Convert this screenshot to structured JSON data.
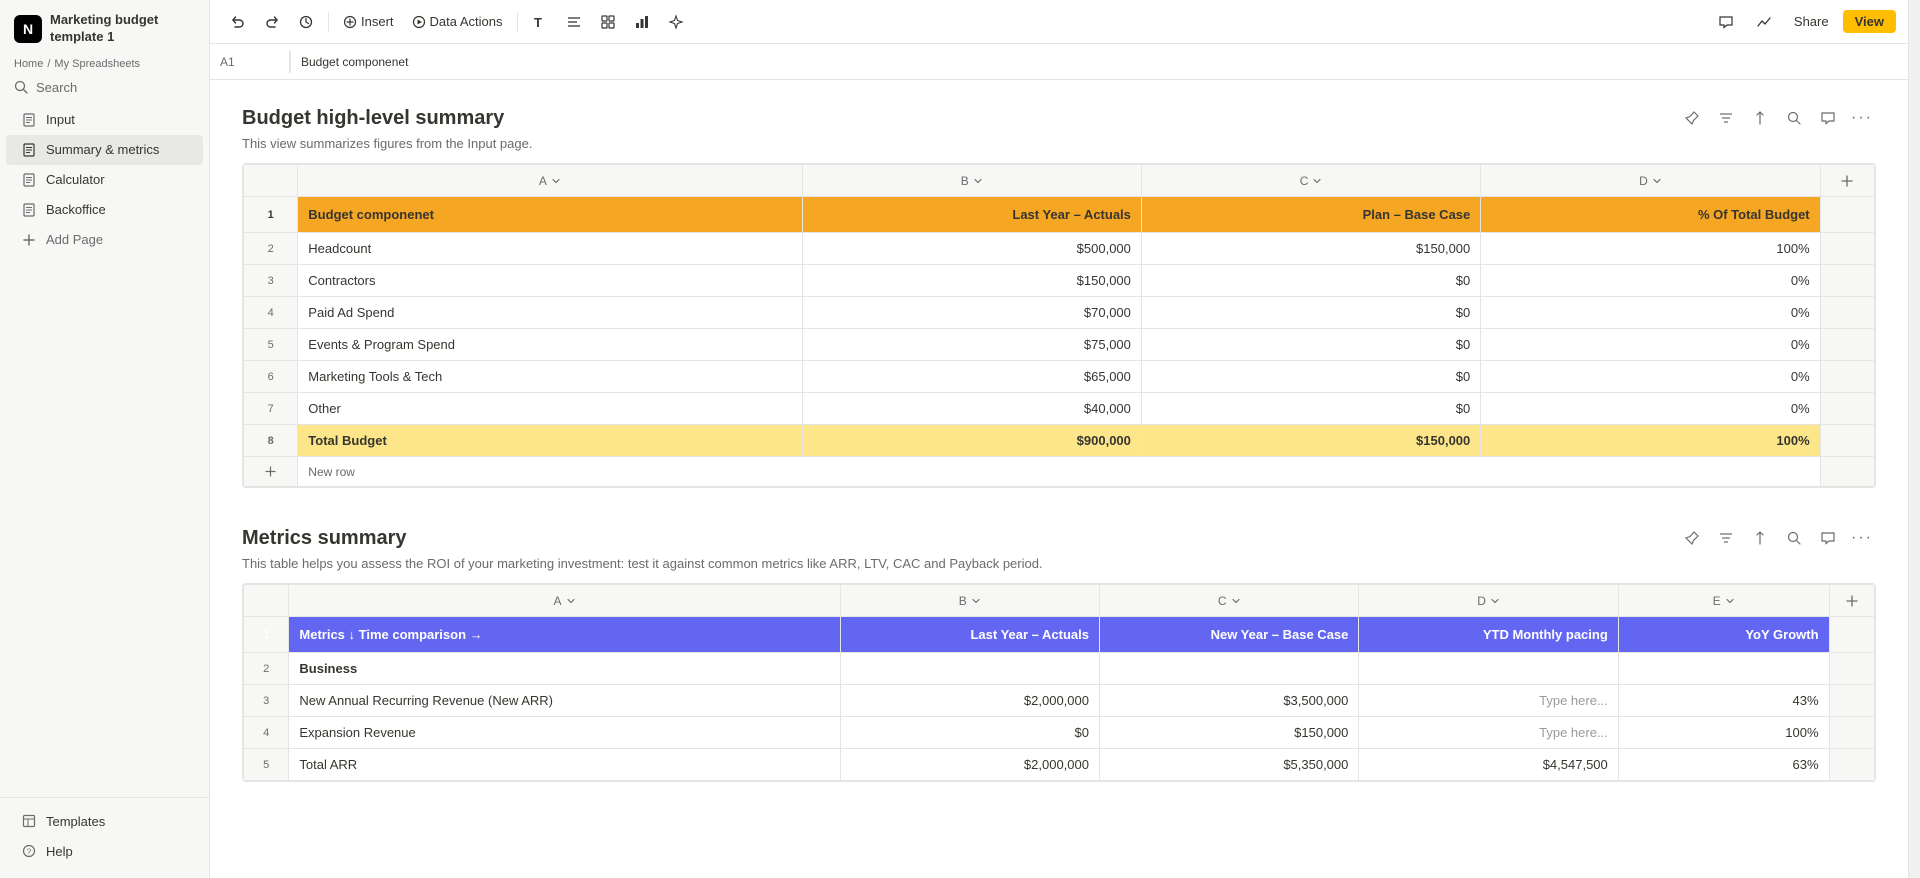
{
  "app": {
    "logo": "N",
    "title": "Marketing budget template 1"
  },
  "sidebar": {
    "breadcrumb": [
      "Home",
      "My Spreadsheets"
    ],
    "search_label": "Search",
    "nav_items": [
      {
        "id": "input",
        "label": "Input",
        "icon": "page"
      },
      {
        "id": "summary-metrics",
        "label": "Summary & metrics",
        "icon": "page",
        "active": true
      },
      {
        "id": "calculator",
        "label": "Calculator",
        "icon": "page"
      },
      {
        "id": "backoffice",
        "label": "Backoffice",
        "icon": "page"
      },
      {
        "id": "add-page",
        "label": "Add Page",
        "icon": "plus"
      }
    ],
    "bottom_items": [
      {
        "id": "templates",
        "label": "Templates",
        "icon": "template"
      },
      {
        "id": "help",
        "label": "Help",
        "icon": "question"
      }
    ]
  },
  "toolbar": {
    "cell_ref": "A1",
    "formula_value": "Budget componenet",
    "undo_label": "Undo",
    "redo_label": "Redo",
    "history_label": "History",
    "insert_label": "Insert",
    "data_actions_label": "Data Actions",
    "share_label": "Share",
    "view_label": "View"
  },
  "budget_section": {
    "title": "Budget high-level summary",
    "subtitle": "This view summarizes figures from the Input page.",
    "col_headers": [
      "A",
      "B",
      "C",
      "D"
    ],
    "headers": [
      "Budget componenet",
      "Last Year – Actuals",
      "Plan – Base Case",
      "% Of Total Budget"
    ],
    "rows": [
      {
        "num": 2,
        "cells": [
          "Headcount",
          "$500,000",
          "$150,000",
          "100%"
        ]
      },
      {
        "num": 3,
        "cells": [
          "Contractors",
          "$150,000",
          "$0",
          "0%"
        ]
      },
      {
        "num": 4,
        "cells": [
          "Paid Ad Spend",
          "$70,000",
          "$0",
          "0%"
        ]
      },
      {
        "num": 5,
        "cells": [
          "Events & Program Spend",
          "$75,000",
          "$0",
          "0%"
        ]
      },
      {
        "num": 6,
        "cells": [
          "Marketing Tools & Tech",
          "$65,000",
          "$0",
          "0%"
        ]
      },
      {
        "num": 7,
        "cells": [
          "Other",
          "$40,000",
          "$0",
          "0%"
        ]
      },
      {
        "num": 8,
        "cells": [
          "Total Budget",
          "$900,000",
          "$150,000",
          "100%"
        ]
      }
    ],
    "new_row_label": "New row"
  },
  "metrics_section": {
    "title": "Metrics summary",
    "subtitle": "This table helps you assess the ROI of your marketing investment: test it against common metrics like ARR, LTV, CAC and Payback period.",
    "col_headers": [
      "A",
      "B",
      "C",
      "D",
      "E"
    ],
    "headers": [
      "Metrics ↓ Time comparison →",
      "Last Year – Actuals",
      "New Year – Base Case",
      "YTD Monthly pacing",
      "YoY Growth"
    ],
    "rows": [
      {
        "num": 2,
        "cells": [
          "Business",
          "",
          "",
          "",
          ""
        ],
        "is_section": true
      },
      {
        "num": 3,
        "cells": [
          "New Annual Recurring Revenue (New ARR)",
          "$2,000,000",
          "$3,500,000",
          "Type here...",
          "43%"
        ]
      },
      {
        "num": 4,
        "cells": [
          "Expansion Revenue",
          "$0",
          "$150,000",
          "Type here...",
          "100%"
        ]
      },
      {
        "num": 5,
        "cells": [
          "Total ARR",
          "$2,000,000",
          "$5,350,000",
          "$4,547,500",
          "63%"
        ]
      }
    ]
  }
}
